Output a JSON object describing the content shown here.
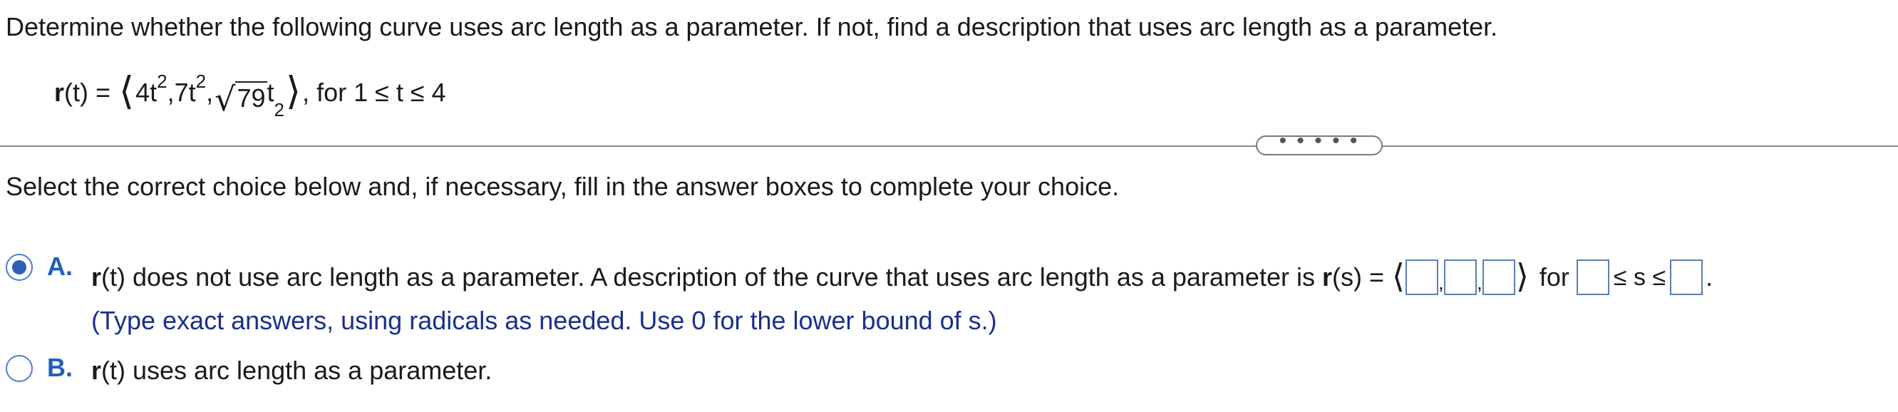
{
  "question": {
    "text": "Determine whether the following curve uses arc length as a parameter. If not, find a description that uses arc length as a parameter."
  },
  "equation": {
    "lhs_bold": "r",
    "lhs_rest": "(t) = ",
    "open_angle": "⟨",
    "c1_base": "4t",
    "c1_exp": "2",
    "sep1": ",",
    "c2_base": "7t",
    "c2_exp": "2",
    "sep2": ",",
    "sqrt_sign": "√",
    "radicand": "79",
    "c3_base": "t",
    "c3_exp": "2",
    "close_angle": "⟩",
    "domain": ", for 1 ≤ t ≤ 4"
  },
  "expand_handle": {
    "label": "• • • • •"
  },
  "instruction": {
    "text": "Select the correct choice below and, if necessary, fill in the answer boxes to complete your choice."
  },
  "choices": {
    "a": {
      "letter": "A.",
      "selected": true,
      "r_bold": "r",
      "text_before": "(t) does not use arc length as a parameter. A description of the curve that uses arc length as a parameter is ",
      "rs_bold": "r",
      "rs_rest": "(s) = ",
      "open_angle": "⟨",
      "comma": ",",
      "close_angle": "⟩",
      "for_label": "for",
      "leq_s_leq": "≤ s ≤",
      "period": ".",
      "hint": "(Type exact answers, using radicals as needed. Use 0 for the lower bound of s.)",
      "inputs": {
        "x_component": "",
        "y_component": "",
        "z_component": "",
        "s_lower": "",
        "s_upper": ""
      }
    },
    "b": {
      "letter": "B.",
      "selected": false,
      "r_bold": "r",
      "text": "(t) uses arc length as a parameter."
    }
  },
  "colors": {
    "choice_letter": "#1f5fbf",
    "hint_text": "#1a2f8c",
    "radio_border": "#4a7fd4",
    "radio_fill": "#2b5fb9",
    "input_border": "#5b7fb0",
    "divider": "#8a8a8a"
  }
}
